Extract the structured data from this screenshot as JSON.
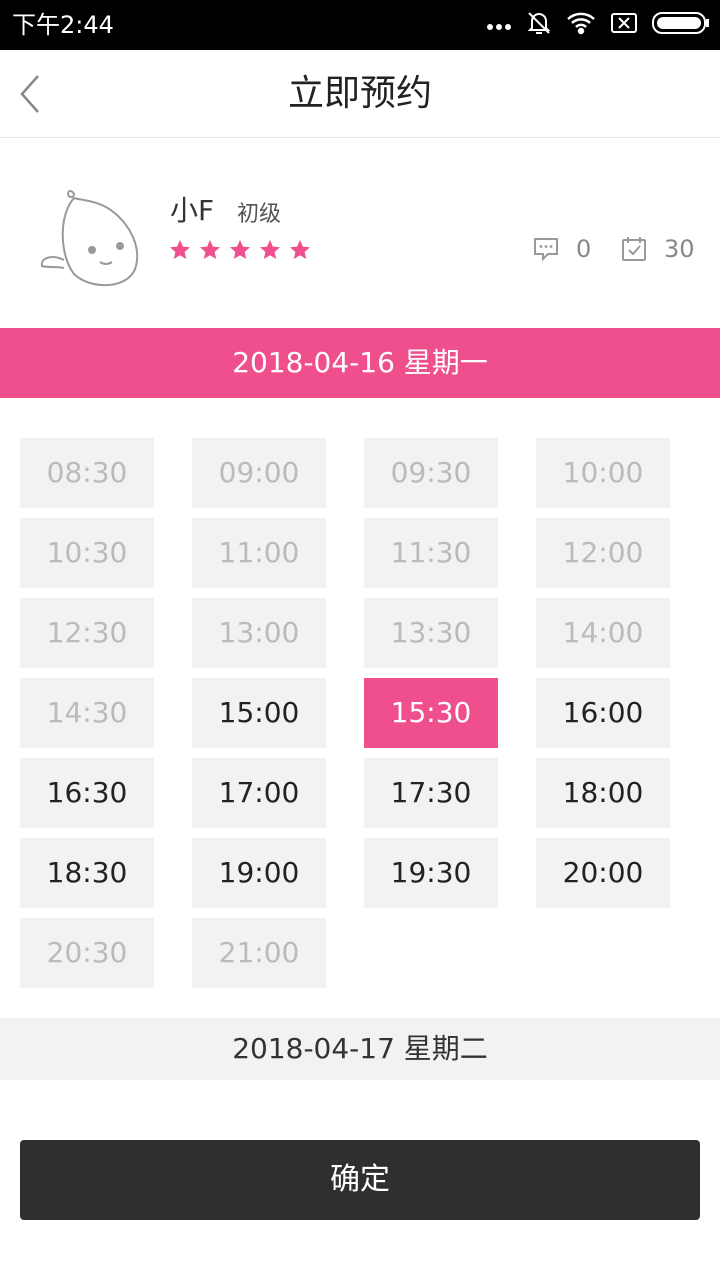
{
  "status_bar": {
    "time": "下午2:44",
    "icons": [
      "more-dots-icon",
      "bell-off-icon",
      "wifi-icon",
      "sim-x-icon",
      "battery-icon"
    ]
  },
  "header": {
    "title": "立即预约",
    "back_icon": "chevron-left-icon"
  },
  "tutor": {
    "name": "小F",
    "level": "初级",
    "rating": 5,
    "comments_count": "0",
    "classes_count": "30",
    "star_color": "#ef4f8c"
  },
  "schedule": {
    "active_date": "2018-04-16 星期一",
    "next_date": "2018-04-17 星期二",
    "slots": [
      {
        "time": "08:30",
        "state": "unavailable"
      },
      {
        "time": "09:00",
        "state": "unavailable"
      },
      {
        "time": "09:30",
        "state": "unavailable"
      },
      {
        "time": "10:00",
        "state": "unavailable"
      },
      {
        "time": "10:30",
        "state": "unavailable"
      },
      {
        "time": "11:00",
        "state": "unavailable"
      },
      {
        "time": "11:30",
        "state": "unavailable"
      },
      {
        "time": "12:00",
        "state": "unavailable"
      },
      {
        "time": "12:30",
        "state": "unavailable"
      },
      {
        "time": "13:00",
        "state": "unavailable"
      },
      {
        "time": "13:30",
        "state": "unavailable"
      },
      {
        "time": "14:00",
        "state": "unavailable"
      },
      {
        "time": "14:30",
        "state": "unavailable"
      },
      {
        "time": "15:00",
        "state": "available"
      },
      {
        "time": "15:30",
        "state": "selected"
      },
      {
        "time": "16:00",
        "state": "available"
      },
      {
        "time": "16:30",
        "state": "available"
      },
      {
        "time": "17:00",
        "state": "available"
      },
      {
        "time": "17:30",
        "state": "available"
      },
      {
        "time": "18:00",
        "state": "available"
      },
      {
        "time": "18:30",
        "state": "available"
      },
      {
        "time": "19:00",
        "state": "available"
      },
      {
        "time": "19:30",
        "state": "available"
      },
      {
        "time": "20:00",
        "state": "available"
      },
      {
        "time": "20:30",
        "state": "unavailable"
      },
      {
        "time": "21:00",
        "state": "unavailable"
      }
    ]
  },
  "confirm_label": "确定",
  "colors": {
    "accent": "#ef4f8c",
    "button_dark": "#2f2f2f",
    "slot_bg": "#f2f2f2",
    "slot_disabled_text": "#bbbbbb"
  }
}
